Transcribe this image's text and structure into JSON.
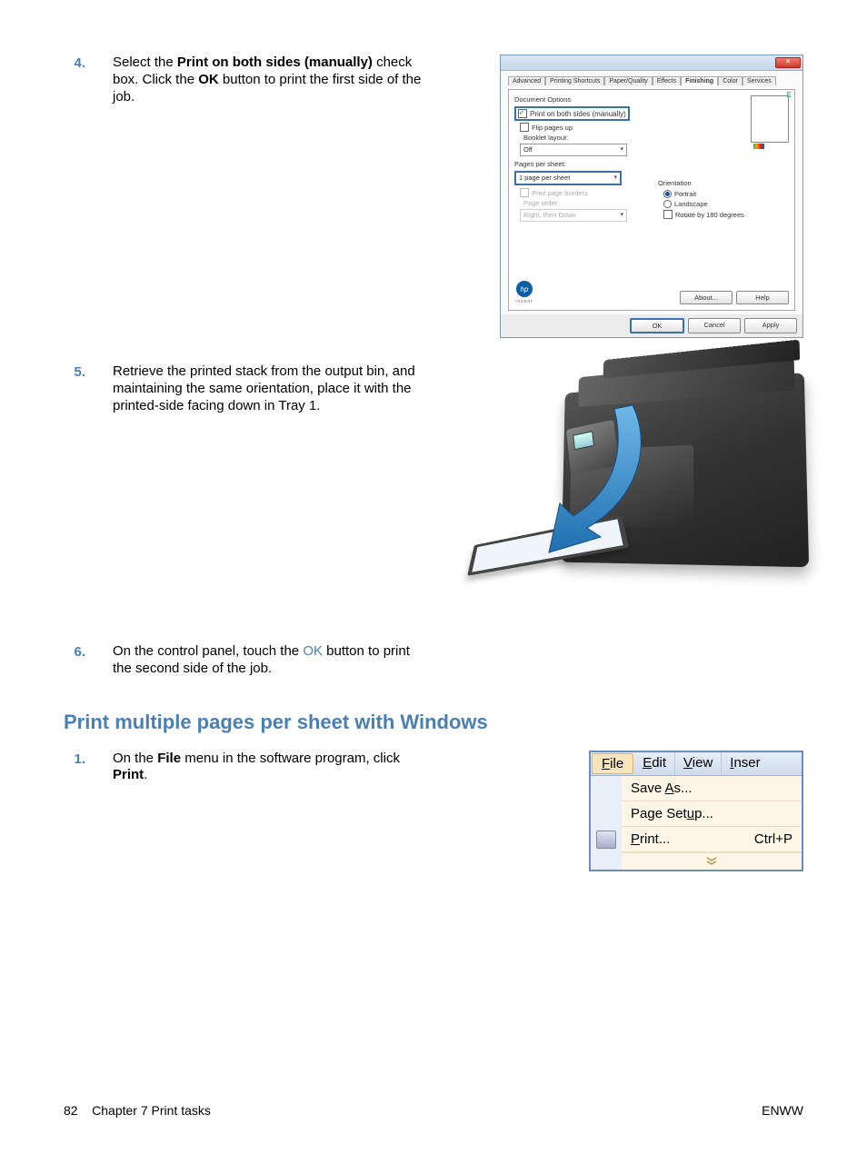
{
  "steps_a": [
    {
      "num": "4.",
      "parts": [
        "Select the ",
        "Print on both sides (manually)",
        " check box. Click the ",
        "OK",
        " button to print the first side of the job."
      ]
    },
    {
      "num": "5.",
      "text": "Retrieve the printed stack from the output bin, and maintaining the same orientation, place it with the printed-side facing down in Tray 1."
    },
    {
      "num": "6.",
      "parts": [
        "On the control panel, touch the ",
        "OK",
        " button to print the second side of the job."
      ]
    }
  ],
  "section2": {
    "heading": "Print multiple pages per sheet with Windows",
    "step1": {
      "num": "1.",
      "parts": [
        "On the ",
        "File",
        " menu in the software program, click ",
        "Print",
        "."
      ]
    }
  },
  "dialog": {
    "tabs": [
      "Advanced",
      "Printing Shortcuts",
      "Paper/Quality",
      "Effects",
      "Finishing",
      "Color",
      "Services"
    ],
    "active_tab": "Finishing",
    "doc_options": "Document Options",
    "print_both": "Print on both sides (manually)",
    "flip": "Flip pages up",
    "booklet_label": "Booklet layout:",
    "booklet_value": "Off",
    "pps_label": "Pages per sheet:",
    "pps_value": "1 page per sheet",
    "print_borders": "Print page borders",
    "page_order_label": "Page order:",
    "page_order_value": "Right, then Down",
    "orientation": "Orientation",
    "portrait": "Portrait",
    "landscape": "Landscape",
    "rotate": "Rotate by 180 degrees",
    "about": "About...",
    "help": "Help",
    "ok": "OK",
    "cancel": "Cancel",
    "apply": "Apply",
    "e_label": "E",
    "invent": "invent"
  },
  "filemenu": {
    "file": "File",
    "edit": "Edit",
    "view": "View",
    "inser": "Inser",
    "save_as": "Save As...",
    "page_setup": "Page Setup...",
    "print": "Print...",
    "shortcut": "Ctrl+P",
    "expand": "▾",
    "underline": {
      "file": "F",
      "edit": "E",
      "view": "V",
      "inser": "I",
      "save_as": "A",
      "page_setup": "u",
      "print": "P"
    }
  },
  "footer": {
    "left_page": "82",
    "left_chapter": "Chapter 7   Print tasks",
    "right": "ENWW"
  }
}
